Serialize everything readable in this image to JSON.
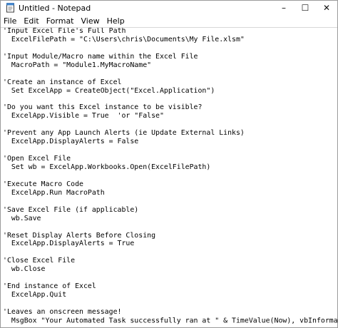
{
  "window": {
    "title": "Untitled - Notepad",
    "controls": {
      "minimize": "–",
      "maximize": "☐",
      "close": "✕"
    }
  },
  "menu": [
    "File",
    "Edit",
    "Format",
    "View",
    "Help"
  ],
  "editor": {
    "lines": [
      "'Input Excel File's Full Path",
      "  ExcelFilePath = \"C:\\Users\\chris\\Documents\\My File.xlsm\"",
      "",
      "'Input Module/Macro name within the Excel File",
      "  MacroPath = \"Module1.MyMacroName\"",
      "",
      "'Create an instance of Excel",
      "  Set ExcelApp = CreateObject(\"Excel.Application\")",
      "",
      "'Do you want this Excel instance to be visible?",
      "  ExcelApp.Visible = True  'or \"False\"",
      "",
      "'Prevent any App Launch Alerts (ie Update External Links)",
      "  ExcelApp.DisplayAlerts = False",
      "",
      "'Open Excel File",
      "  Set wb = ExcelApp.Workbooks.Open(ExcelFilePath)",
      "",
      "'Execute Macro Code",
      "  ExcelApp.Run MacroPath",
      "",
      "'Save Excel File (if applicable)",
      "  wb.Save",
      "",
      "'Reset Display Alerts Before Closing",
      "  ExcelApp.DisplayAlerts = True",
      "",
      "'Close Excel File",
      "  wb.Close",
      "",
      "'End instance of Excel",
      "  ExcelApp.Quit",
      "",
      "'Leaves an onscreen message!",
      "  MsgBox \"Your Automated Task successfully ran at \" & TimeValue(Now), vbInformation"
    ]
  }
}
